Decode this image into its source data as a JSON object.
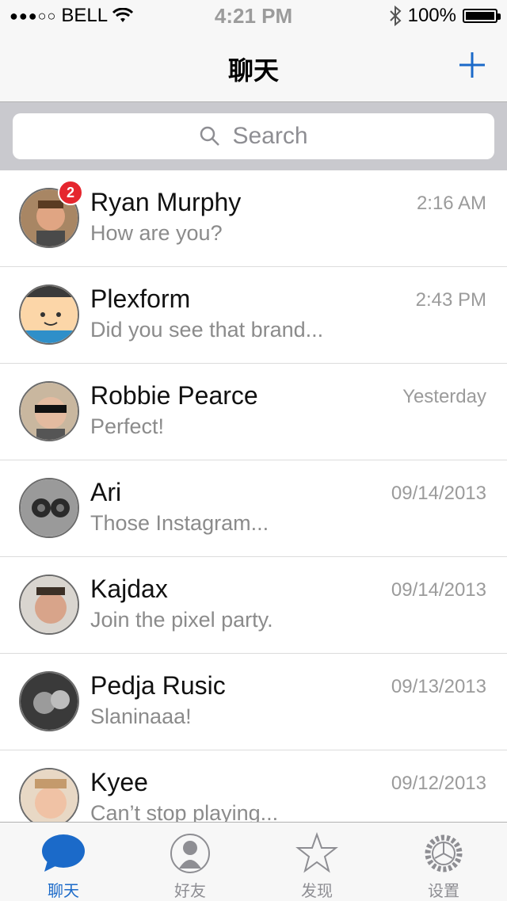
{
  "status": {
    "carrier": "BELL",
    "time": "4:21 PM",
    "battery": "100%",
    "signal_dots": "●●●○○"
  },
  "nav": {
    "title": "聊天"
  },
  "search": {
    "placeholder": "Search"
  },
  "chats": [
    {
      "name": "Ryan Murphy",
      "message": "How are you?",
      "time": "2:16 AM",
      "badge": "2"
    },
    {
      "name": "Plexform",
      "message": "Did you see that brand...",
      "time": "2:43 PM"
    },
    {
      "name": "Robbie Pearce",
      "message": "Perfect!",
      "time": "Yesterday"
    },
    {
      "name": "Ari",
      "message": "Those Instagram...",
      "time": "09/14/2013"
    },
    {
      "name": "Kajdax",
      "message": "Join the pixel party.",
      "time": "09/14/2013"
    },
    {
      "name": "Pedja Rusic",
      "message": "Slaninaaa!",
      "time": "09/13/2013"
    },
    {
      "name": "Kyee",
      "message": "Can’t stop playing...",
      "time": "09/12/2013"
    }
  ],
  "tabs": [
    {
      "label": "聊天",
      "icon": "chat-bubble-icon",
      "active": true
    },
    {
      "label": "好友",
      "icon": "contacts-icon"
    },
    {
      "label": "发现",
      "icon": "star-icon"
    },
    {
      "label": "设置",
      "icon": "gear-icon"
    }
  ],
  "colors": {
    "accent": "#1b6ac9",
    "badge": "#e5262e",
    "bar_bg": "#f7f7f7",
    "search_bg": "#c9c9ce"
  }
}
